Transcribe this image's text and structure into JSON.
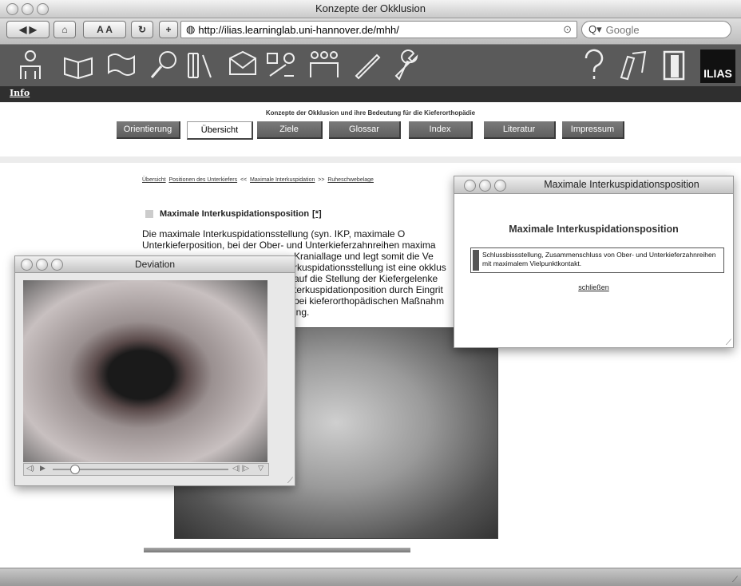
{
  "browser": {
    "title": "Konzepte der Okklusion",
    "url": "http://ilias.learninglab.uni-hannover.de/mhh/",
    "search_placeholder": "Google"
  },
  "ilias": {
    "logo": "ILIAS",
    "info_link": "Info"
  },
  "page": {
    "subtitle": "Konzepte der Okklusion und ihre Bedeutung für die Kieferorthopädie",
    "tabs": [
      "Orientierung",
      "Übersicht",
      "Ziele",
      "Glossar",
      "Index",
      "Literatur",
      "Impressum"
    ],
    "active_tab": "Übersicht",
    "breadcrumb": {
      "c1": "Übersicht",
      "c2": "Positionen des Unterkiefers",
      "prev": "<<",
      "c3": "Maximale Interkuspidation",
      "next": ">>",
      "c4": "Ruheschwebelage"
    },
    "heading": "Maximale Interkuspidationsposition",
    "heading_link": "[*]",
    "paragraph": {
      "l1": "Die maximale Interkuspidationsstellung (syn. IKP, maximale O",
      "l2": "Unterkieferposition, bei der Ober- und Unterkieferzahnreihen maxima",
      "l3": "Kraniallage und legt somit die Ve",
      "l4": "rkuspidationsstellung ist eine okklus",
      "l5": "auf die Stellung der Kiefergelenke",
      "l6": "terkuspidationposition durch Eingrit",
      "l7": "bei kieferorthopädischen Maßnahm",
      "l8": "ing."
    }
  },
  "deviation_window": {
    "title": "Deviation"
  },
  "popup": {
    "title": "Maximale Interkuspidationsposition",
    "heading": "Maximale Interkuspidationsposition",
    "definition": "Schlussbissstellung, Zusammenschluss von Ober- und Unterkieferzahnreihen mit maximalem Vielpunktkontakt.",
    "close": "schließen"
  }
}
